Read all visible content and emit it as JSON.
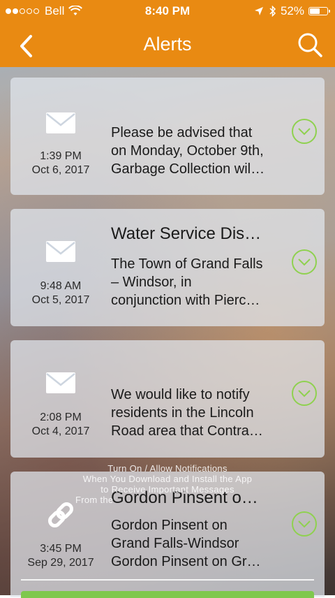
{
  "status_bar": {
    "carrier": "Bell",
    "time": "8:40 PM",
    "battery": "52%",
    "battery_level": 0.52
  },
  "nav": {
    "title": "Alerts",
    "back_icon": "chevron-left-icon",
    "search_icon": "search-icon"
  },
  "alerts": [
    {
      "icon": "envelope-icon",
      "time": "1:39 PM",
      "date": "Oct 6, 2017",
      "title": "",
      "lines": [
        "Please be advised that",
        "on Monday, October 9th,",
        "Garbage Collection wil…"
      ]
    },
    {
      "icon": "envelope-icon",
      "time": "9:48 AM",
      "date": "Oct 5, 2017",
      "title": "Water Service Dis…",
      "lines": [
        "The Town of Grand Falls",
        "– Windsor, in",
        "conjunction with Pierc…"
      ]
    },
    {
      "icon": "envelope-icon",
      "time": "2:08 PM",
      "date": "Oct 4, 2017",
      "title": "",
      "lines": [
        "We would like to notify",
        "residents in the Lincoln",
        "Road area that Contra…"
      ]
    },
    {
      "icon": "link-icon",
      "time": "3:45 PM",
      "date": "Sep 29, 2017",
      "title": "Gordon Pinsent o…",
      "lines": [
        "Gordon Pinsent on",
        "Grand Falls-Windsor",
        "Gordon Pinsent on Gr…"
      ]
    }
  ],
  "overlay_notice": {
    "line1": "Turn On / Allow Notifications",
    "line2": "When You Download and Install the App",
    "line3": "to Receive Important Messages",
    "line4": "From the"
  },
  "colors": {
    "accent": "#e98a12",
    "chevron": "#8fd14f",
    "card_bg": "#e2e7ee"
  }
}
